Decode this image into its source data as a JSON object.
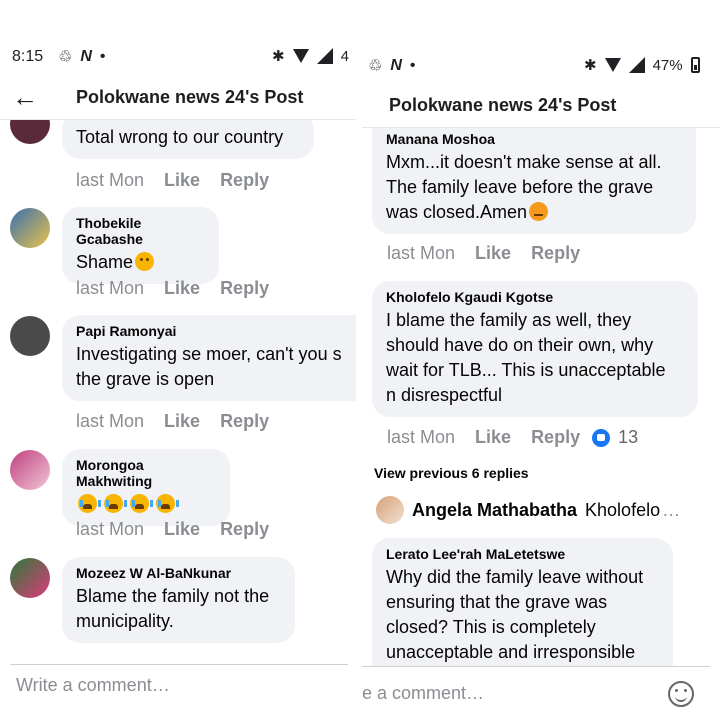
{
  "left": {
    "status": {
      "time": "8:15",
      "battery_partial": "4"
    },
    "header": {
      "back_icon": "arrow-left-icon",
      "title": "Polokwane news 24's Post"
    },
    "comments": [
      {
        "author": "",
        "text": "Total wrong to our country",
        "time": "last Mon",
        "like": "Like",
        "reply": "Reply"
      },
      {
        "author": "Thobekile Gcabashe",
        "text": "Shame",
        "time": "last Mon",
        "like": "Like",
        "reply": "Reply"
      },
      {
        "author": "Papi Ramonyai",
        "text1": "Investigating se moer, can't you s",
        "text2": "the grave is open",
        "time": "last Mon",
        "like": "Like",
        "reply": "Reply"
      },
      {
        "author": "Morongoa Makhwiting",
        "text": "",
        "time": "last Mon",
        "like": "Like",
        "reply": "Reply"
      },
      {
        "author": "Mozeez W Al-BaNkunar",
        "text1": "Blame the family not the",
        "text2": "municipality."
      }
    ],
    "composer_placeholder": "Write a comment…"
  },
  "right": {
    "status": {
      "battery": "47%"
    },
    "header": {
      "title": "Polokwane news 24's Post"
    },
    "comments": [
      {
        "author": "Manana Moshoa",
        "text1": "Mxm...it doesn't make sense at all.",
        "text2": "The family leave before the grave",
        "text3": "was closed.Amen",
        "time": "last Mon",
        "like": "Like",
        "reply": "Reply"
      },
      {
        "author": "Kholofelo Kgaudi Kgotse",
        "text1": "I blame the family as well, they",
        "text2": "should have do on their own, why",
        "text3": "wait for TLB... This is unacceptable",
        "text4": "n disrespectful",
        "time": "last Mon",
        "like": "Like",
        "reply": "Reply",
        "reactions": "13"
      },
      {
        "author": "Lerato Lee'rah MaLetetswe",
        "text1": "Why did the family leave without",
        "text2": "ensuring that the grave was",
        "text3": "closed? This is completely",
        "text4": "unacceptable and irresponsible"
      }
    ],
    "view_previous": "View previous 6 replies",
    "inline_reply": {
      "name": "Angela Mathabatha",
      "snippet": "Kholofelo",
      "ellipsis": "…"
    },
    "composer_placeholder": "e a comment…"
  },
  "colors": {
    "bubble": "#f0f2f5",
    "meta": "#8a8d91",
    "brand": "#1877f2"
  }
}
